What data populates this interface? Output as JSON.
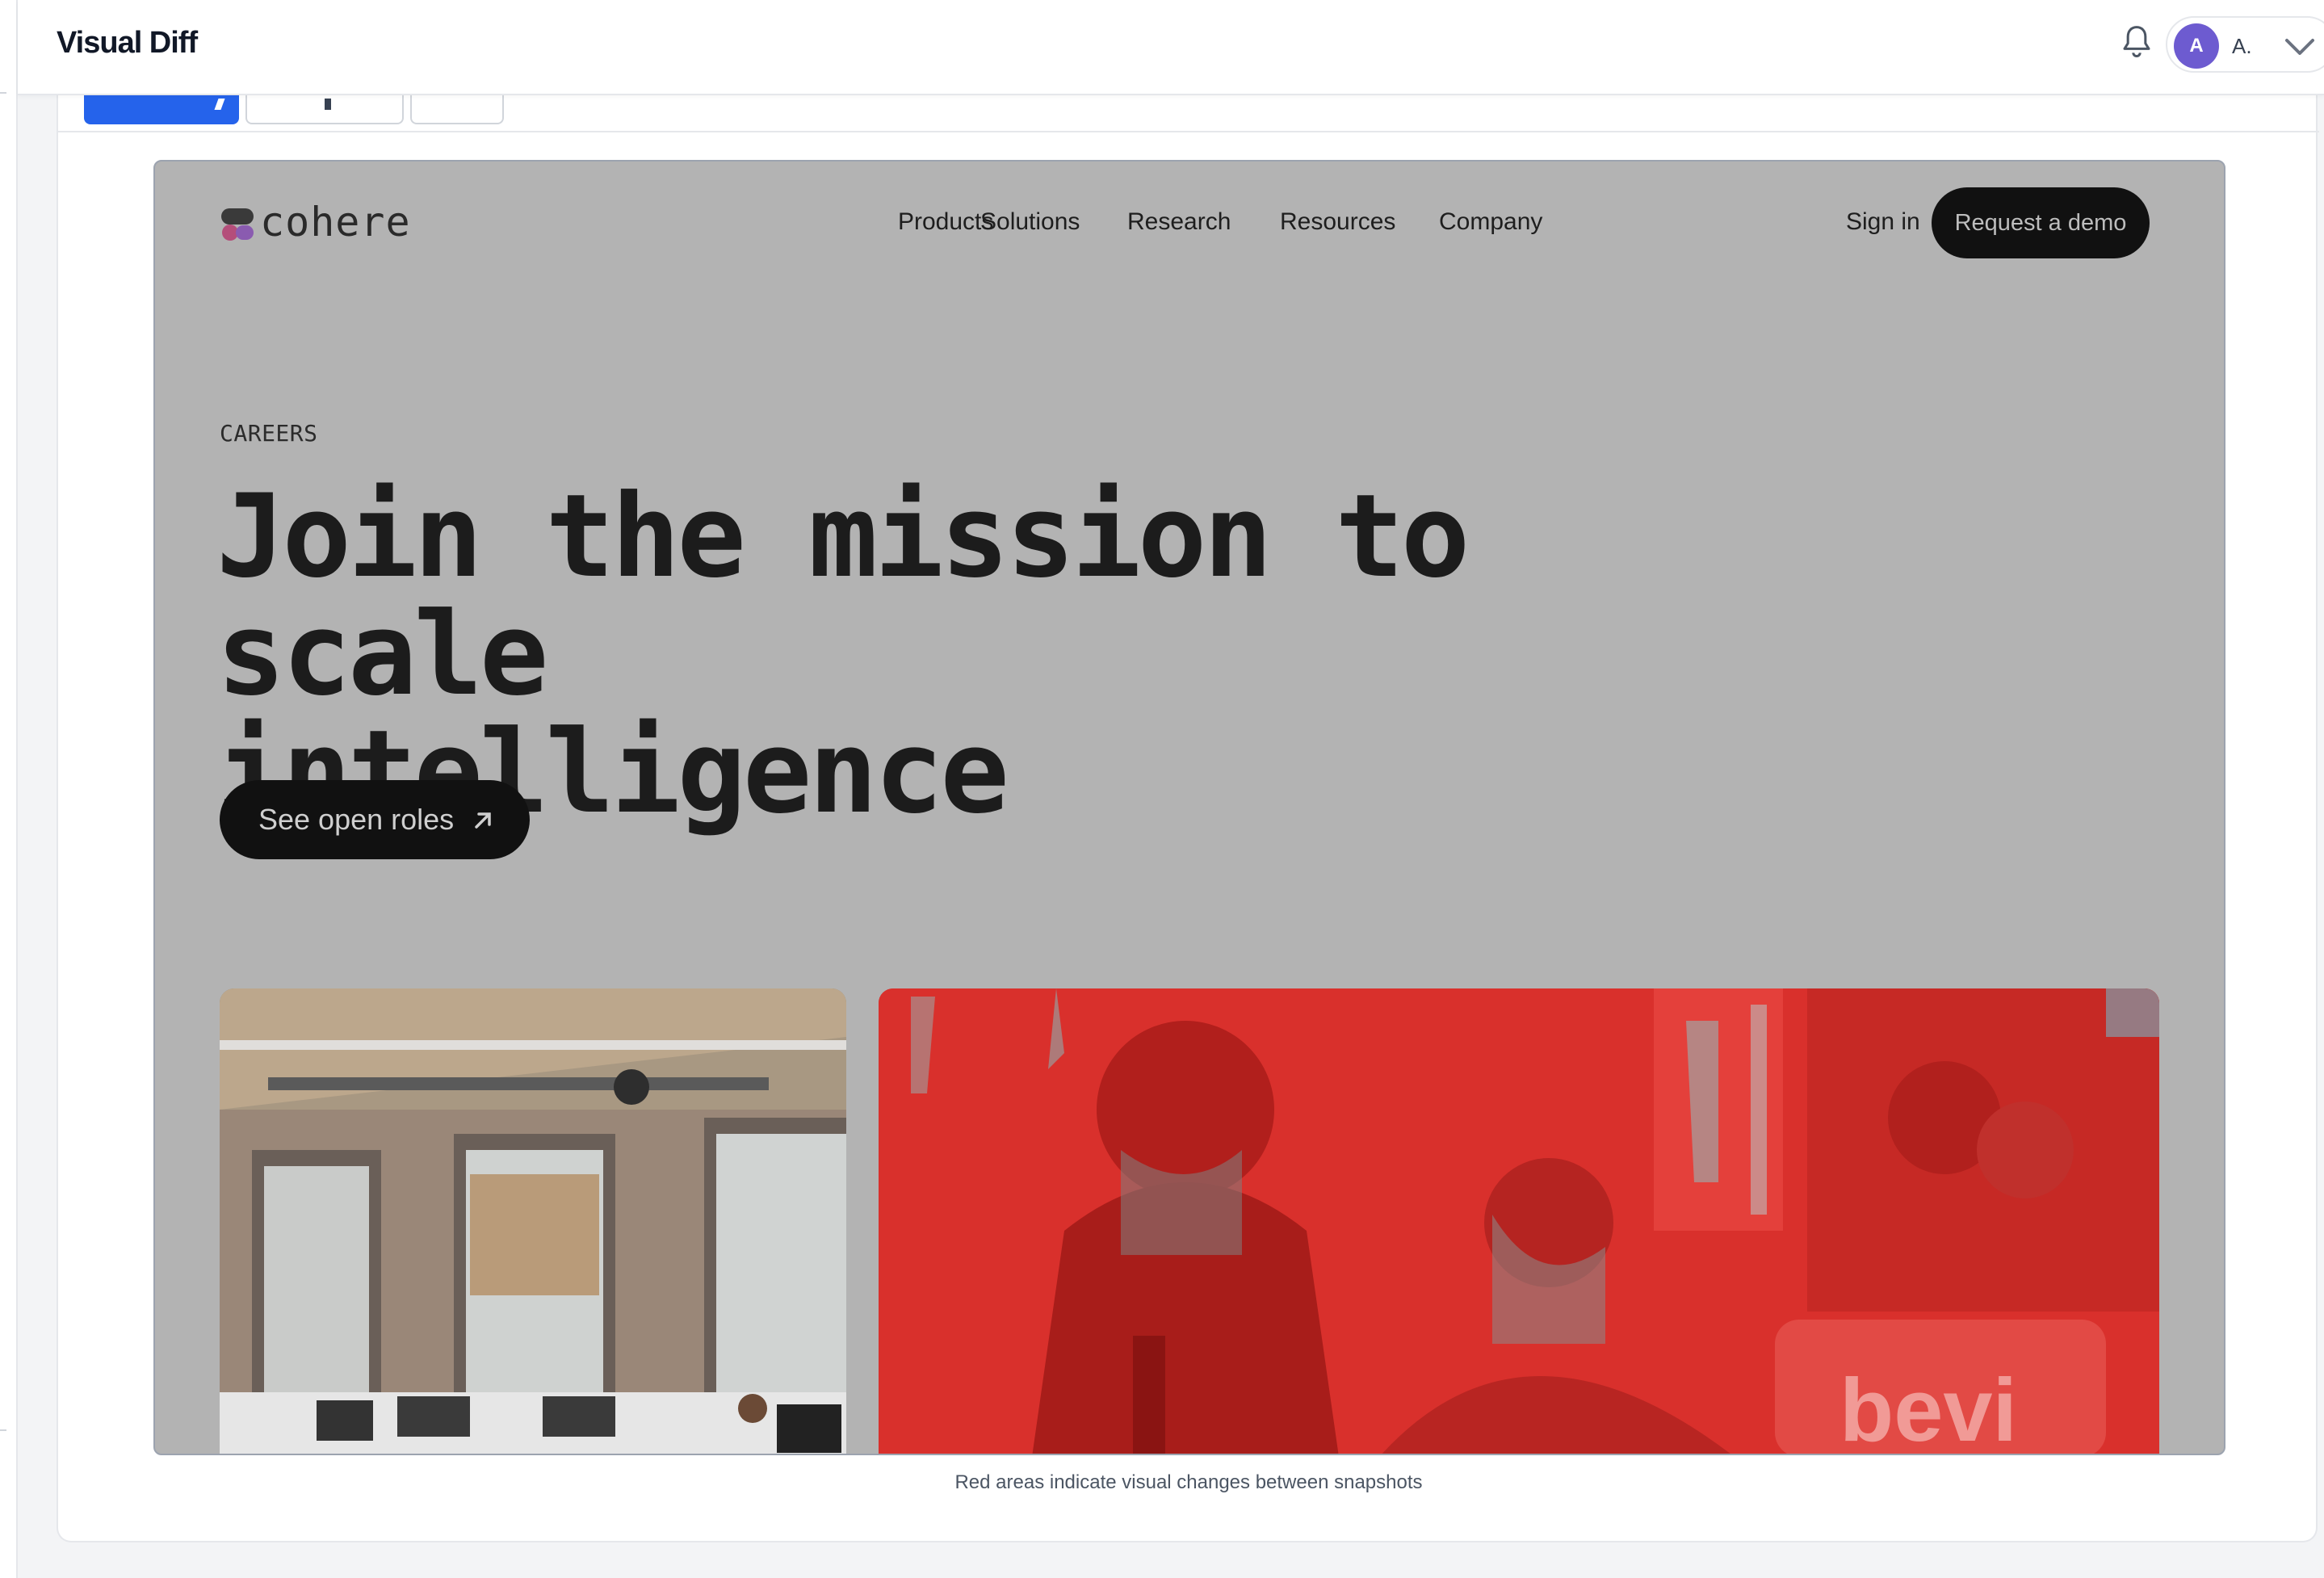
{
  "app": {
    "title": "Visual Diff",
    "user_initial": "A",
    "user_name": "A.",
    "accent_color": "#2563eb",
    "avatar_color": "#6d5bd0"
  },
  "icons": {
    "bell": "bell-icon",
    "chevron": "chevron-down-icon",
    "arrow": "arrow-up-right-icon"
  },
  "snapshot": {
    "site_name": "cohere",
    "nav": [
      "Products",
      "Solutions",
      "Research",
      "Resources",
      "Company"
    ],
    "sign_in": "Sign in",
    "demo": "Request a demo",
    "eyebrow": "CAREERS",
    "headline_line1": "Join the mission to scale",
    "headline_line2": "intelligence",
    "cta": "See open roles",
    "photo_right_text": "bevi",
    "diff_color": "#d9302c"
  },
  "caption": "Red areas indicate visual changes between snapshots"
}
